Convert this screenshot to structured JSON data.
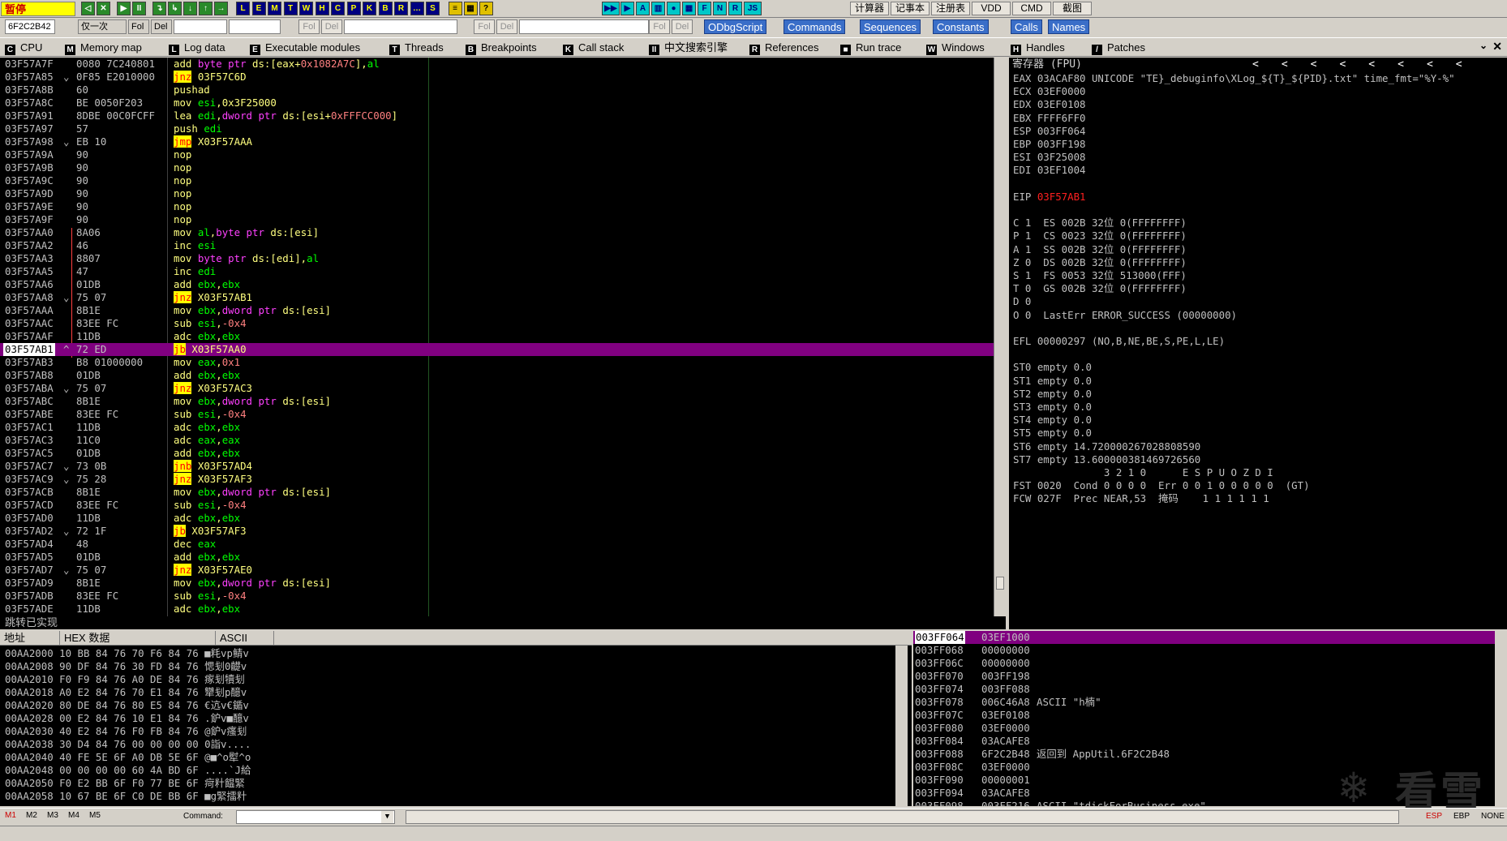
{
  "toolbar": {
    "status": "暂停",
    "buttons_left": [
      "◁",
      "✕",
      "▶",
      "II",
      "↴",
      "↳",
      "↓",
      "↑",
      "→"
    ],
    "buttons_views": [
      "L",
      "E",
      "M",
      "T",
      "W",
      "H",
      "C",
      "P",
      "K",
      "B",
      "R",
      "…",
      "S"
    ],
    "buttons_misc": [
      "≡",
      "▦",
      "?"
    ],
    "buttons_mid": [
      "▶▶",
      "▶",
      "A",
      "▥",
      "●",
      "▦",
      "F",
      "N",
      "R",
      "JS"
    ],
    "tools": [
      "计算器",
      "记事本",
      "注册表",
      "VDD",
      "CMD",
      "截图"
    ]
  },
  "row2": {
    "addr": "6F2C2B42",
    "mode": "仅一次",
    "fol": "Fol",
    "del": "Del",
    "plugins": [
      "ODbgScript",
      "Commands",
      "Sequences",
      "Constants",
      "Calls",
      "Names"
    ]
  },
  "tabs": [
    {
      "icon": "C",
      "label": "CPU"
    },
    {
      "icon": "M",
      "label": "Memory map"
    },
    {
      "icon": "L",
      "label": "Log data"
    },
    {
      "icon": "E",
      "label": "Executable modules"
    },
    {
      "icon": "T",
      "label": "Threads"
    },
    {
      "icon": "B",
      "label": "Breakpoints"
    },
    {
      "icon": "K",
      "label": "Call stack"
    },
    {
      "icon": "II",
      "label": "中文搜索引擎"
    },
    {
      "icon": "R",
      "label": "References"
    },
    {
      "icon": "■",
      "label": "Run trace"
    },
    {
      "icon": "W",
      "label": "Windows"
    },
    {
      "icon": "H",
      "label": "Handles"
    },
    {
      "icon": "/",
      "label": "Patches"
    }
  ],
  "disasm": [
    {
      "a": "03F57A7F",
      "m": "",
      "h": "0080 7C240801",
      "op": "add",
      "args": [
        [
          "kw",
          "byte ptr "
        ],
        [
          "arg",
          "ds:[eax+"
        ],
        [
          "num",
          "0x1082A7C"
        ],
        [
          "arg",
          "],"
        ],
        [
          "reg",
          "al"
        ]
      ]
    },
    {
      "a": "03F57A85",
      "m": "⌄",
      "h": "0F85 E2010000",
      "op": "jnz",
      "j": true,
      "args": [
        [
          "arg",
          "03F57C6D"
        ]
      ]
    },
    {
      "a": "03F57A8B",
      "m": "",
      "h": "60",
      "op": "pushad",
      "args": []
    },
    {
      "a": "03F57A8C",
      "m": "",
      "h": "BE 0050F203",
      "op": "mov",
      "args": [
        [
          "reg",
          "esi"
        ],
        [
          "arg",
          ",0x3F25000"
        ]
      ]
    },
    {
      "a": "03F57A91",
      "m": "",
      "h": "8DBE 00C0FCFF",
      "op": "lea",
      "args": [
        [
          "reg",
          "edi"
        ],
        [
          "arg",
          ","
        ],
        [
          "kw",
          "dword ptr "
        ],
        [
          "arg",
          "ds:[esi+"
        ],
        [
          "num",
          "0xFFFCC000"
        ],
        [
          "arg",
          "]"
        ]
      ]
    },
    {
      "a": "03F57A97",
      "m": "",
      "h": "57",
      "op": "push",
      "args": [
        [
          "reg",
          "edi"
        ]
      ]
    },
    {
      "a": "03F57A98",
      "m": "⌄",
      "h": "EB 10",
      "op": "jmp",
      "j": true,
      "args": [
        [
          "arg",
          "X03F57AAA"
        ]
      ]
    },
    {
      "a": "03F57A9A",
      "m": "",
      "h": "90",
      "op": "nop",
      "args": []
    },
    {
      "a": "03F57A9B",
      "m": "",
      "h": "90",
      "op": "nop",
      "args": []
    },
    {
      "a": "03F57A9C",
      "m": "",
      "h": "90",
      "op": "nop",
      "args": []
    },
    {
      "a": "03F57A9D",
      "m": "",
      "h": "90",
      "op": "nop",
      "args": []
    },
    {
      "a": "03F57A9E",
      "m": "",
      "h": "90",
      "op": "nop",
      "args": []
    },
    {
      "a": "03F57A9F",
      "m": "",
      "h": "90",
      "op": "nop",
      "args": []
    },
    {
      "a": "03F57AA0",
      "m": "",
      "h": "8A06",
      "op": "mov",
      "args": [
        [
          "reg",
          "al"
        ],
        [
          "arg",
          ","
        ],
        [
          "kw",
          "byte ptr "
        ],
        [
          "arg",
          "ds:[esi]"
        ]
      ]
    },
    {
      "a": "03F57AA2",
      "m": "",
      "h": "46",
      "op": "inc",
      "args": [
        [
          "reg",
          "esi"
        ]
      ]
    },
    {
      "a": "03F57AA3",
      "m": "",
      "h": "8807",
      "op": "mov",
      "args": [
        [
          "kw",
          "byte ptr "
        ],
        [
          "arg",
          "ds:[edi],"
        ],
        [
          "reg",
          "al"
        ]
      ]
    },
    {
      "a": "03F57AA5",
      "m": "",
      "h": "47",
      "op": "inc",
      "args": [
        [
          "reg",
          "edi"
        ]
      ]
    },
    {
      "a": "03F57AA6",
      "m": "",
      "h": "01DB",
      "op": "add",
      "args": [
        [
          "reg",
          "ebx"
        ],
        [
          "arg",
          ","
        ],
        [
          "reg",
          "ebx"
        ]
      ]
    },
    {
      "a": "03F57AA8",
      "m": "⌄",
      "h": "75 07",
      "op": "jnz",
      "j": true,
      "args": [
        [
          "arg",
          "X03F57AB1"
        ]
      ]
    },
    {
      "a": "03F57AAA",
      "m": "",
      "h": "8B1E",
      "op": "mov",
      "args": [
        [
          "reg",
          "ebx"
        ],
        [
          "arg",
          ","
        ],
        [
          "kw",
          "dword ptr "
        ],
        [
          "arg",
          "ds:[esi]"
        ]
      ]
    },
    {
      "a": "03F57AAC",
      "m": "",
      "h": "83EE FC",
      "op": "sub",
      "args": [
        [
          "reg",
          "esi"
        ],
        [
          "arg",
          ","
        ],
        [
          "num",
          "-0x4"
        ]
      ]
    },
    {
      "a": "03F57AAF",
      "m": "",
      "h": "11DB",
      "op": "adc",
      "args": [
        [
          "reg",
          "ebx"
        ],
        [
          "arg",
          ","
        ],
        [
          "reg",
          "ebx"
        ]
      ]
    },
    {
      "a": "03F57AB1",
      "m": "^",
      "h": "72 ED",
      "op": "jb",
      "j": true,
      "sel": true,
      "args": [
        [
          "arg",
          "X03F57AA0"
        ]
      ]
    },
    {
      "a": "03F57AB3",
      "m": "",
      "h": "B8 01000000",
      "op": "mov",
      "args": [
        [
          "reg",
          "eax"
        ],
        [
          "arg",
          ","
        ],
        [
          "num",
          "0x1"
        ]
      ]
    },
    {
      "a": "03F57AB8",
      "m": "",
      "h": "01DB",
      "op": "add",
      "args": [
        [
          "reg",
          "ebx"
        ],
        [
          "arg",
          ","
        ],
        [
          "reg",
          "ebx"
        ]
      ]
    },
    {
      "a": "03F57ABA",
      "m": "⌄",
      "h": "75 07",
      "op": "jnz",
      "j": true,
      "args": [
        [
          "arg",
          "X03F57AC3"
        ]
      ]
    },
    {
      "a": "03F57ABC",
      "m": "",
      "h": "8B1E",
      "op": "mov",
      "args": [
        [
          "reg",
          "ebx"
        ],
        [
          "arg",
          ","
        ],
        [
          "kw",
          "dword ptr "
        ],
        [
          "arg",
          "ds:[esi]"
        ]
      ]
    },
    {
      "a": "03F57ABE",
      "m": "",
      "h": "83EE FC",
      "op": "sub",
      "args": [
        [
          "reg",
          "esi"
        ],
        [
          "arg",
          ","
        ],
        [
          "num",
          "-0x4"
        ]
      ]
    },
    {
      "a": "03F57AC1",
      "m": "",
      "h": "11DB",
      "op": "adc",
      "args": [
        [
          "reg",
          "ebx"
        ],
        [
          "arg",
          ","
        ],
        [
          "reg",
          "ebx"
        ]
      ]
    },
    {
      "a": "03F57AC3",
      "m": "",
      "h": "11C0",
      "op": "adc",
      "args": [
        [
          "reg",
          "eax"
        ],
        [
          "arg",
          ","
        ],
        [
          "reg",
          "eax"
        ]
      ]
    },
    {
      "a": "03F57AC5",
      "m": "",
      "h": "01DB",
      "op": "add",
      "args": [
        [
          "reg",
          "ebx"
        ],
        [
          "arg",
          ","
        ],
        [
          "reg",
          "ebx"
        ]
      ]
    },
    {
      "a": "03F57AC7",
      "m": "⌄",
      "h": "73 0B",
      "op": "jnb",
      "j": true,
      "args": [
        [
          "arg",
          "X03F57AD4"
        ]
      ]
    },
    {
      "a": "03F57AC9",
      "m": "⌄",
      "h": "75 28",
      "op": "jnz",
      "j": true,
      "args": [
        [
          "arg",
          "X03F57AF3"
        ]
      ]
    },
    {
      "a": "03F57ACB",
      "m": "",
      "h": "8B1E",
      "op": "mov",
      "args": [
        [
          "reg",
          "ebx"
        ],
        [
          "arg",
          ","
        ],
        [
          "kw",
          "dword ptr "
        ],
        [
          "arg",
          "ds:[esi]"
        ]
      ]
    },
    {
      "a": "03F57ACD",
      "m": "",
      "h": "83EE FC",
      "op": "sub",
      "args": [
        [
          "reg",
          "esi"
        ],
        [
          "arg",
          ","
        ],
        [
          "num",
          "-0x4"
        ]
      ]
    },
    {
      "a": "03F57AD0",
      "m": "",
      "h": "11DB",
      "op": "adc",
      "args": [
        [
          "reg",
          "ebx"
        ],
        [
          "arg",
          ","
        ],
        [
          "reg",
          "ebx"
        ]
      ]
    },
    {
      "a": "03F57AD2",
      "m": "⌄",
      "h": "72 1F",
      "op": "jb",
      "j": true,
      "args": [
        [
          "arg",
          "X03F57AF3"
        ]
      ]
    },
    {
      "a": "03F57AD4",
      "m": "",
      "h": "48",
      "op": "dec",
      "args": [
        [
          "reg",
          "eax"
        ]
      ]
    },
    {
      "a": "03F57AD5",
      "m": "",
      "h": "01DB",
      "op": "add",
      "args": [
        [
          "reg",
          "ebx"
        ],
        [
          "arg",
          ","
        ],
        [
          "reg",
          "ebx"
        ]
      ]
    },
    {
      "a": "03F57AD7",
      "m": "⌄",
      "h": "75 07",
      "op": "jnz",
      "j": true,
      "args": [
        [
          "arg",
          "X03F57AE0"
        ]
      ]
    },
    {
      "a": "03F57AD9",
      "m": "",
      "h": "8B1E",
      "op": "mov",
      "args": [
        [
          "reg",
          "ebx"
        ],
        [
          "arg",
          ","
        ],
        [
          "kw",
          "dword ptr "
        ],
        [
          "arg",
          "ds:[esi]"
        ]
      ]
    },
    {
      "a": "03F57ADB",
      "m": "",
      "h": "83EE FC",
      "op": "sub",
      "args": [
        [
          "reg",
          "esi"
        ],
        [
          "arg",
          ","
        ],
        [
          "num",
          "-0x4"
        ]
      ]
    },
    {
      "a": "03F57ADE",
      "m": "",
      "h": "11DB",
      "op": "adc",
      "args": [
        [
          "reg",
          "ebx"
        ],
        [
          "arg",
          ","
        ],
        [
          "reg",
          "ebx"
        ]
      ]
    }
  ],
  "info_line": "跳转已实现",
  "registers": {
    "title": "寄存器 (FPU)",
    "arrows": [
      "<",
      "<",
      "<",
      "<",
      "<",
      "<",
      "<",
      "<"
    ],
    "lines": [
      "EAX 03ACAF80 UNICODE \"TE}_debuginfo\\XLog_${T}_${PID}.txt\" time_fmt=\"%Y-%\"",
      "ECX 03EF0000",
      "EDX 03EF0108",
      "EBX FFFF6FF0",
      "ESP 003FF064",
      "EBP 003FF198",
      "ESI 03F25008",
      "EDI 03EF1004",
      "",
      "EIP |03F57AB1",
      "",
      "C 1  ES 002B 32位 0(FFFFFFFF)",
      "P 1  CS 0023 32位 0(FFFFFFFF)",
      "A 1  SS 002B 32位 0(FFFFFFFF)",
      "Z 0  DS 002B 32位 0(FFFFFFFF)",
      "S 1  FS 0053 32位 513000(FFF)",
      "T 0  GS 002B 32位 0(FFFFFFFF)",
      "D 0",
      "O 0  LastErr ERROR_SUCCESS (00000000)",
      "",
      "EFL 00000297 (NO,B,NE,BE,S,PE,L,LE)",
      "",
      "ST0 empty 0.0",
      "ST1 empty 0.0",
      "ST2 empty 0.0",
      "ST3 empty 0.0",
      "ST4 empty 0.0",
      "ST5 empty 0.0",
      "ST6 empty 14.720000267028808590",
      "ST7 empty 13.600000381469726560",
      "               3 2 1 0      E S P U O Z D I",
      "FST 0020  Cond 0 0 0 0  Err 0 0 1 0 0 0 0 0  (GT)",
      "FCW 027F  Prec NEAR,53  掩码    1 1 1 1 1 1"
    ]
  },
  "dump": {
    "headers": [
      "地址",
      "HEX 数据",
      "ASCII"
    ],
    "rows": [
      "00AA2000 10 BB 84 76 70 F6 84 76 ■粍vp鲭v",
      "00AA2008 90 DF 84 76 30 FD 84 76 愢刬0齼v",
      "00AA2010 F0 F9 84 76 A0 DE 84 76 瘃刬犢刬",
      "00AA2018 A0 E2 84 76 70 E1 84 76 犫刬p醷v",
      "00AA2020 80 DE 84 76 80 E5 84 76 €迒v€鍎v",
      "00AA2028 00 E2 84 76 10 E1 84 76 .鈩v■醷v",
      "00AA2030 40 E2 84 76 F0 FB 84 76 @鈩v瘙刬",
      "00AA2038 30 D4 84 76 00 00 00 00 0詣v....",
      "00AA2040 40 FE 5E 6F A0 DB 5E 6F @■^o犚^o",
      "00AA2048 00 00 00 00 60 4A BD 6F ....`J給",
      "00AA2050 F0 E2 BB 6F F0 77 BE 6F 疴籵饂緊",
      "00AA2058 10 67 BE 6F C0 DE BB 6F ■g緊擂籵"
    ]
  },
  "stack": [
    {
      "a": "003FF064",
      "v": "03EF1000",
      "c": "",
      "sel": true
    },
    {
      "a": "003FF068",
      "v": "00000000",
      "c": ""
    },
    {
      "a": "003FF06C",
      "v": "00000000",
      "c": ""
    },
    {
      "a": "003FF070",
      "v": "003FF198",
      "c": ""
    },
    {
      "a": "003FF074",
      "v": "003FF088",
      "c": ""
    },
    {
      "a": "003FF078",
      "v": "006C46A8",
      "c": "ASCII \"h楠\""
    },
    {
      "a": "003FF07C",
      "v": "03EF0108",
      "c": ""
    },
    {
      "a": "003FF080",
      "v": "03EF0000",
      "c": ""
    },
    {
      "a": "003FF084",
      "v": "03ACAFE8",
      "c": ""
    },
    {
      "a": "003FF088",
      "v": "6F2C2B48",
      "c": "返回到 AppUtil.6F2C2B48"
    },
    {
      "a": "003FF08C",
      "v": "03EF0000",
      "c": ""
    },
    {
      "a": "003FF090",
      "v": "00000001",
      "c": ""
    },
    {
      "a": "003FF094",
      "v": "03ACAFE8",
      "c": ""
    },
    {
      "a": "003FF098",
      "v": "003FF216",
      "c": "ASCII \"tdickForBusiness.exe\""
    }
  ],
  "watermark": "看雪",
  "bottom": {
    "marks": [
      "M1",
      "M2",
      "M3",
      "M4",
      "M5"
    ],
    "command_label": "Command:",
    "right": [
      "ESP",
      "EBP",
      "NONE"
    ]
  }
}
